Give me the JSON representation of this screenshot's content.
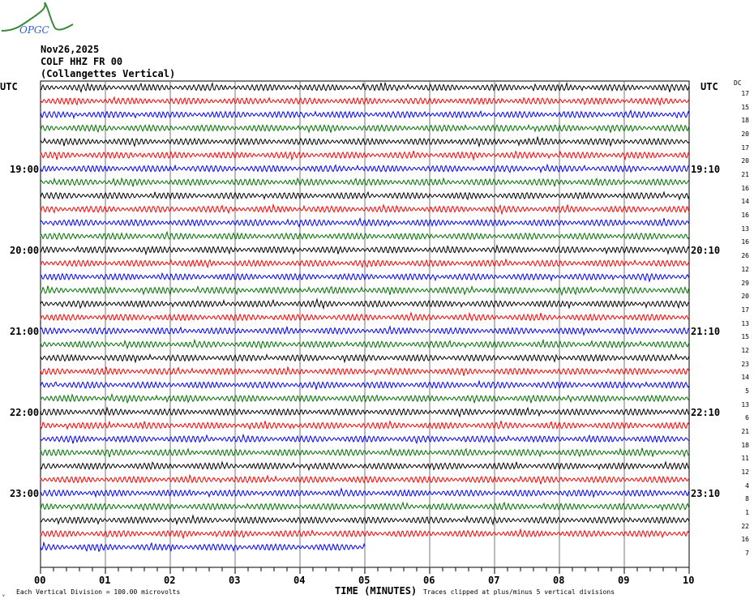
{
  "logo_text": "OPGC",
  "header": {
    "date": "Nov26,2025",
    "station": "COLF HHZ FR 00",
    "location": "(Collangettes Vertical)"
  },
  "chart_data": {
    "type": "line",
    "title": "COLF HHZ FR 00 (Collangettes Vertical)",
    "xlabel": "TIME (MINUTES)",
    "xlim": [
      0,
      10
    ],
    "x_ticks": [
      "00",
      "01",
      "02",
      "03",
      "04",
      "05",
      "06",
      "07",
      "08",
      "09",
      "10"
    ],
    "left_axis_label": "UTC",
    "right_axis_label": "UTC",
    "dc_label": "DC",
    "minutes_per_line": 10,
    "last_line_end_minute": 5,
    "trace_colors": [
      "#000000",
      "#ff0000",
      "#0000ff",
      "#007000"
    ],
    "left_hour_labels": [
      {
        "row": 6,
        "text": "19:00"
      },
      {
        "row": 12,
        "text": "20:00"
      },
      {
        "row": 18,
        "text": "21:00"
      },
      {
        "row": 24,
        "text": "22:00"
      },
      {
        "row": 30,
        "text": "23:00"
      }
    ],
    "right_hour_labels": [
      {
        "row": 6,
        "text": "19:10"
      },
      {
        "row": 12,
        "text": "20:10"
      },
      {
        "row": 18,
        "text": "21:10"
      },
      {
        "row": 24,
        "text": "22:10"
      },
      {
        "row": 30,
        "text": "23:10"
      }
    ],
    "dc_offsets": [
      17,
      15,
      18,
      20,
      17,
      20,
      21,
      16,
      14,
      16,
      13,
      16,
      26,
      12,
      29,
      20,
      17,
      13,
      15,
      12,
      23,
      14,
      5,
      13,
      6,
      21,
      18,
      11,
      12,
      4,
      8,
      1,
      22,
      16,
      7
    ],
    "footer_left": "Each Vertical Division =  100.00 microvolts",
    "footer_right": "Traces clipped at plus/minus 5 vertical divisions"
  }
}
